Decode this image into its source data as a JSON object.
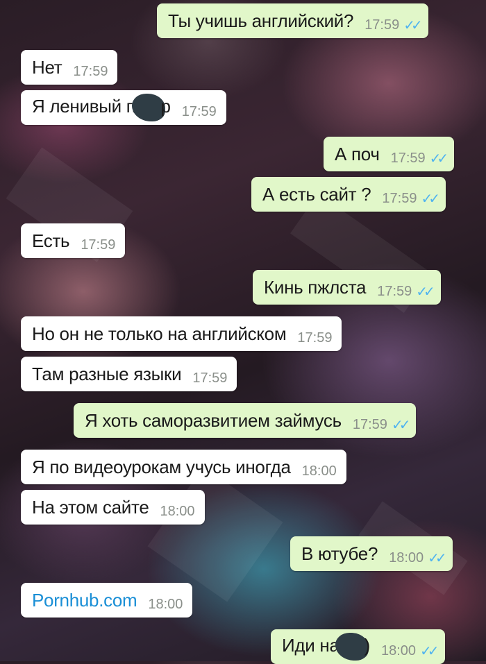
{
  "messages": [
    {
      "side": "out",
      "text": "Ты учишь английский?",
      "time": "17:59",
      "ticks": "✓✓"
    },
    {
      "side": "in",
      "text": "Нет",
      "time": "17:59"
    },
    {
      "side": "in",
      "text": "Я ленивый п",
      "text_after": "р",
      "time": "17:59"
    },
    {
      "side": "out",
      "text": "А поч",
      "time": "17:59",
      "ticks": "✓✓"
    },
    {
      "side": "out",
      "text": "А есть сайт ?",
      "time": "17:59",
      "ticks": "✓✓"
    },
    {
      "side": "in",
      "text": "Есть",
      "time": "17:59"
    },
    {
      "side": "out",
      "text": "Кинь пжлста",
      "time": "17:59",
      "ticks": "✓✓"
    },
    {
      "side": "in",
      "text": "Но он не только на английском",
      "time": "17:59"
    },
    {
      "side": "in",
      "text": "Там разные языки",
      "time": "17:59"
    },
    {
      "side": "out",
      "text": "Я хоть саморазвитием займусь",
      "time": "17:59",
      "ticks": "✓✓"
    },
    {
      "side": "in",
      "text": "Я по видеоурокам учусь иногда",
      "time": "18:00"
    },
    {
      "side": "in",
      "text": "На этом сайте",
      "time": "18:00"
    },
    {
      "side": "out",
      "text": "В ютубе?",
      "time": "18:00",
      "ticks": "✓✓"
    },
    {
      "side": "in",
      "text": "Pornhub.com",
      "time": "18:00",
      "link": true
    },
    {
      "side": "out",
      "text": "Иди на",
      "text_after": ")",
      "time": "18:00",
      "ticks": "✓✓"
    }
  ]
}
